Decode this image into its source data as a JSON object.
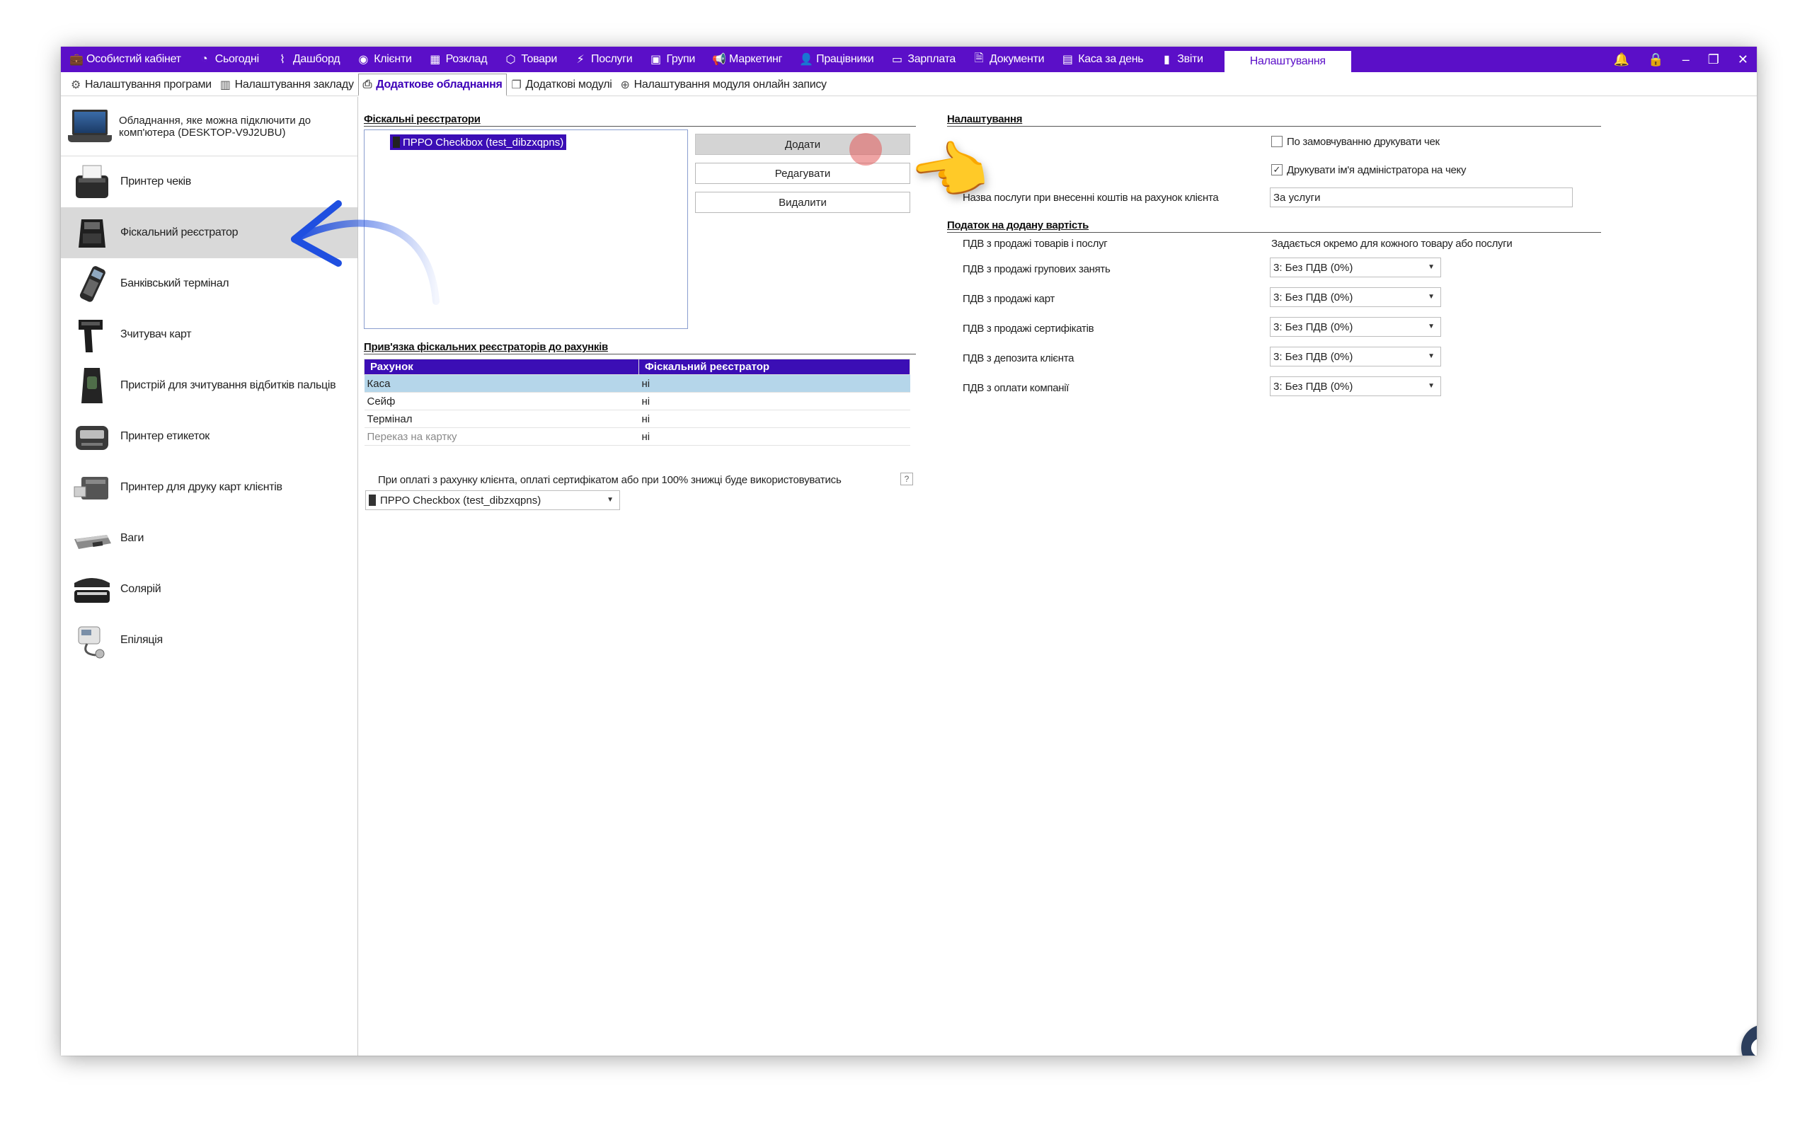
{
  "topnav": {
    "items": [
      {
        "label": "Особистий кабінет",
        "icon": "briefcase-icon",
        "glyph": "💼"
      },
      {
        "label": "Сьогодні",
        "icon": "clock-icon",
        "glyph": "◔"
      },
      {
        "label": "Дашборд",
        "icon": "pulse-icon",
        "glyph": "⌇"
      },
      {
        "label": "Клієнти",
        "icon": "user-circle-icon",
        "glyph": "◉"
      },
      {
        "label": "Розклад",
        "icon": "calendar-icon",
        "glyph": "▦"
      },
      {
        "label": "Товари",
        "icon": "box-icon",
        "glyph": "⬡"
      },
      {
        "label": "Послуги",
        "icon": "bolt-icon",
        "glyph": "⚡"
      },
      {
        "label": "Групи",
        "icon": "group-icon",
        "glyph": "▣"
      },
      {
        "label": "Маркетинг",
        "icon": "megaphone-icon",
        "glyph": "📢"
      },
      {
        "label": "Працівники",
        "icon": "person-icon",
        "glyph": "👤"
      },
      {
        "label": "Зарплата",
        "icon": "money-icon",
        "glyph": "▭"
      },
      {
        "label": "Документи",
        "icon": "document-icon",
        "glyph": "🗎"
      },
      {
        "label": "Каса за день",
        "icon": "calculator-icon",
        "glyph": "▤"
      },
      {
        "label": "Звіти",
        "icon": "bar-chart-icon",
        "glyph": "▮"
      }
    ],
    "active": "Налаштування"
  },
  "subtabs": [
    {
      "label": "Налаштування програми",
      "icon": "gear-icon",
      "glyph": "⚙"
    },
    {
      "label": "Налаштування закладу",
      "icon": "building-icon",
      "glyph": "▥"
    },
    {
      "label": "Додаткове обладнання",
      "icon": "printer-icon",
      "glyph": "⎙",
      "active": true
    },
    {
      "label": "Додаткові модулі",
      "icon": "window-icon",
      "glyph": "❐"
    },
    {
      "label": "Налаштування модуля онлайн запису",
      "icon": "globe-icon",
      "glyph": "⊕"
    }
  ],
  "left": {
    "header": "Обладнання, яке можна підключити до комп'ютера (DESKTOP-V9J2UBU)",
    "devices": [
      "Принтер чеків",
      "Фіскальний реєстратор",
      "Банківський термінал",
      "Зчитувач карт",
      "Пристрій для зчитування відбитків пальців",
      "Принтер етикеток",
      "Принтер для друку карт клієнтів",
      "Ваги",
      "Солярій",
      "Епіляція"
    ]
  },
  "fiscal": {
    "title": "Фіскальні реєстратори",
    "items": [
      "ПРРО Checkbox (test_dibzxqpns)"
    ],
    "buttons": {
      "add": "Додати",
      "edit": "Редагувати",
      "delete": "Видалити"
    }
  },
  "binding": {
    "title": "Прив'язка фіскальних реєстраторів до рахунків",
    "headers": [
      "Рахунок",
      "Фіскальний реєстратор"
    ],
    "rows": [
      [
        "Каса",
        "ні"
      ],
      [
        "Сейф",
        "ні"
      ],
      [
        "Термінал",
        "ні"
      ],
      [
        "Переказ на картку",
        "ні"
      ]
    ]
  },
  "payment": {
    "note": "При оплаті з рахунку клієнта, оплаті сертифікатом або при 100% знижці буде використовуватись",
    "help": "?",
    "selected": "ПРРО Checkbox (test_dibzxqpns)"
  },
  "settings": {
    "title": "Налаштування",
    "print_default": "По замовчуванню друкувати чек",
    "print_default_checked": false,
    "print_admin": "Друкувати ім'я адміністратора на чеку",
    "print_admin_checked": true,
    "service_name_label": "Назва послуги при внесенні коштів на рахунок клієнта",
    "service_name_value": "За услуги"
  },
  "vat": {
    "title": "Податок на додану вартість",
    "goods_label": "ПДВ з продажі товарів і послуг",
    "goods_value": "Задається окремо для кожного товару або послуги",
    "rows": [
      {
        "label": "ПДВ з продажі групових занять",
        "value": "3: Без ПДВ (0%)"
      },
      {
        "label": "ПДВ з продажі карт",
        "value": "3: Без ПДВ (0%)"
      },
      {
        "label": "ПДВ з продажі сертифікатів",
        "value": "3: Без ПДВ (0%)"
      },
      {
        "label": "ПДВ з депозита клієнта",
        "value": "3: Без ПДВ (0%)"
      },
      {
        "label": "ПДВ з оплати компанії",
        "value": "3: Без ПДВ (0%)"
      }
    ]
  },
  "colors": {
    "accent": "#5b0fc8",
    "selection": "#3b0eb5",
    "row_highlight": "#b5d6ea",
    "arrow": "#1f4fe0"
  }
}
